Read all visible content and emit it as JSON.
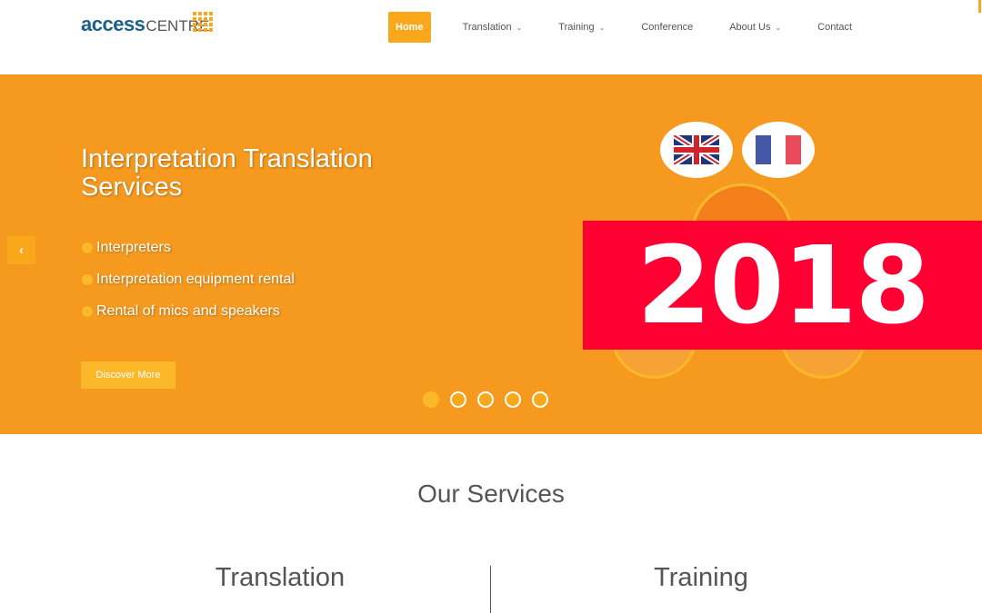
{
  "header": {
    "logo_main": "access",
    "logo_sub": "CENTRE",
    "nav": [
      {
        "label": "Home",
        "active": true
      },
      {
        "label": "Translation",
        "dropdown": true
      },
      {
        "label": "Training",
        "dropdown": true
      },
      {
        "label": "Conference"
      },
      {
        "label": "About Us",
        "dropdown": true
      },
      {
        "label": "Contact"
      }
    ]
  },
  "hero": {
    "title": "Interpretation Translation Services",
    "bullets": [
      "Interpreters",
      "Interpretation equipment rental",
      "Rental of mics and speakers"
    ],
    "cta": "Discover More",
    "slide_count": 5,
    "active_slide": 1,
    "banner": "2018",
    "background_color": "#f59a1f",
    "accent": "#f9a81c",
    "banner_color": "#ff0033"
  },
  "services": {
    "title": "Our Services",
    "columns": [
      "Translation",
      "Training"
    ]
  }
}
